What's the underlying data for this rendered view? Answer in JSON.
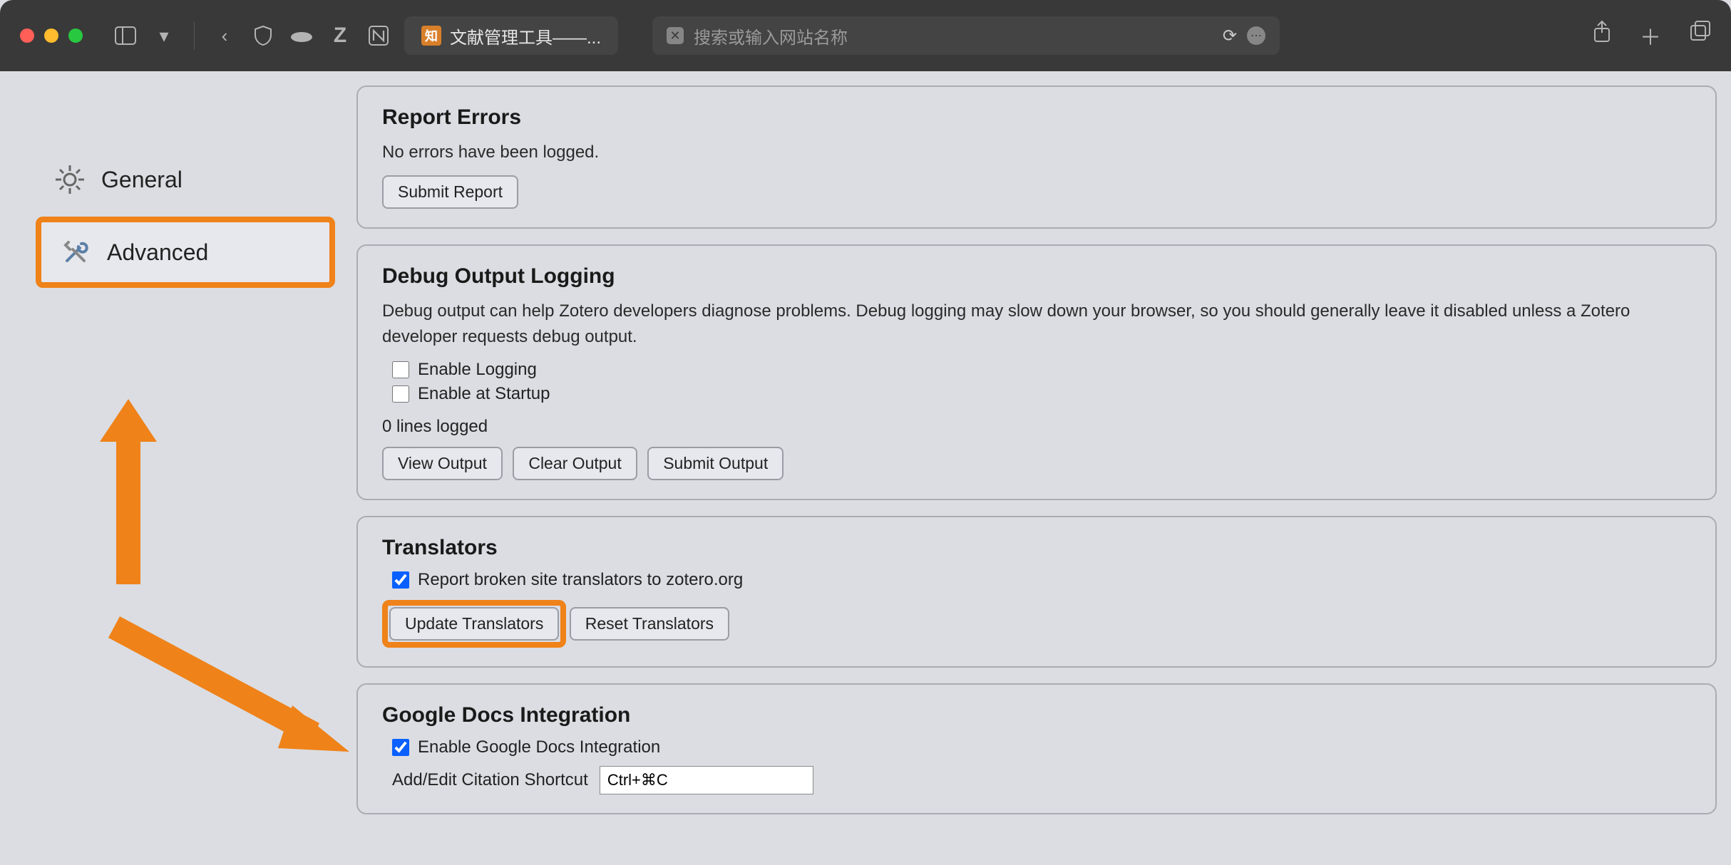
{
  "titlebar": {
    "tab_title": "文献管理工具——...",
    "search_placeholder": "搜索或输入网站名称"
  },
  "sidebar": {
    "items": [
      {
        "label": "General"
      },
      {
        "label": "Advanced"
      }
    ]
  },
  "report_errors": {
    "heading": "Report Errors",
    "status": "No errors have been logged.",
    "submit_label": "Submit Report"
  },
  "debug": {
    "heading": "Debug Output Logging",
    "desc": "Debug output can help Zotero developers diagnose problems. Debug logging may slow down your browser, so you should generally leave it disabled unless a Zotero developer requests debug output.",
    "enable_logging_label": "Enable Logging",
    "enable_startup_label": "Enable at Startup",
    "lines_logged": "0 lines logged",
    "view_label": "View Output",
    "clear_label": "Clear Output",
    "submit_label": "Submit Output"
  },
  "translators": {
    "heading": "Translators",
    "report_broken_label": "Report broken site translators to zotero.org",
    "update_label": "Update Translators",
    "reset_label": "Reset Translators"
  },
  "gdocs": {
    "heading": "Google Docs Integration",
    "enable_label": "Enable Google Docs Integration",
    "shortcut_label": "Add/Edit Citation Shortcut",
    "shortcut_value": "Ctrl+⌘C"
  }
}
